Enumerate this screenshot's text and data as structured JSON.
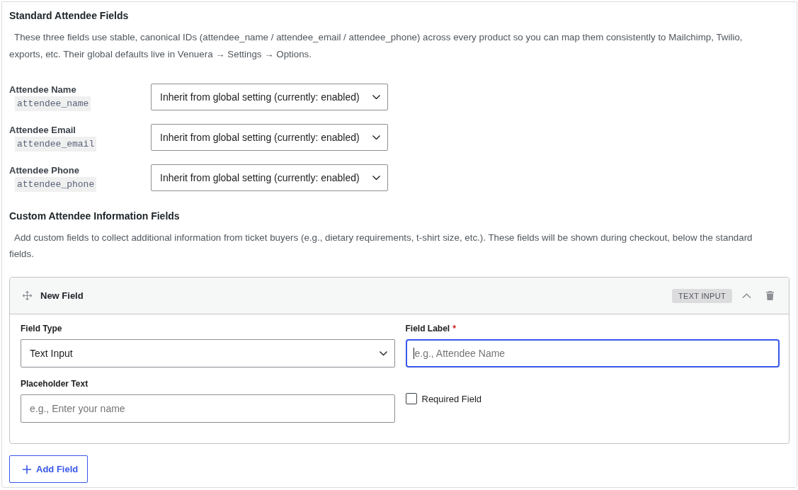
{
  "standard_section": {
    "title": "Standard Attendee Fields",
    "description": "These three fields use stable, canonical IDs (attendee_name / attendee_email / attendee_phone) across every product so you can map them consistently to Mailchimp, Twilio, exports, etc. Their global defaults live in Venuera → Settings → Options.",
    "fields": [
      {
        "label": "Attendee Name",
        "field_key": "attendee_name",
        "value": "Inherit from global setting (currently: enabled)"
      },
      {
        "label": "Attendee Email",
        "field_key": "attendee_email",
        "value": "Inherit from global setting (currently: enabled)"
      },
      {
        "label": "Attendee Phone",
        "field_key": "attendee_phone",
        "value": "Inherit from global setting (currently: enabled)"
      }
    ]
  },
  "custom_section": {
    "title": "Custom Attendee Information Fields",
    "description": "Add custom fields to collect additional information from ticket buyers (e.g., dietary requirements, t-shirt size, etc.). These fields will be shown during checkout, below the standard fields.",
    "field_cards": [
      {
        "title": "New Field",
        "type_badge": "TEXT INPUT",
        "expanded": true,
        "field_type": {
          "label": "Field Type",
          "value": "Text Input"
        },
        "field_label": {
          "label": "Field Label",
          "required_mark": "*",
          "placeholder": "e.g., Attendee Name",
          "focused": true
        },
        "placeholder_text": {
          "label": "Placeholder Text",
          "placeholder": "e.g., Enter your name",
          "focused": false
        },
        "required": {
          "label": "Required Field",
          "checked": false
        }
      }
    ],
    "add_button": "Add Field"
  }
}
